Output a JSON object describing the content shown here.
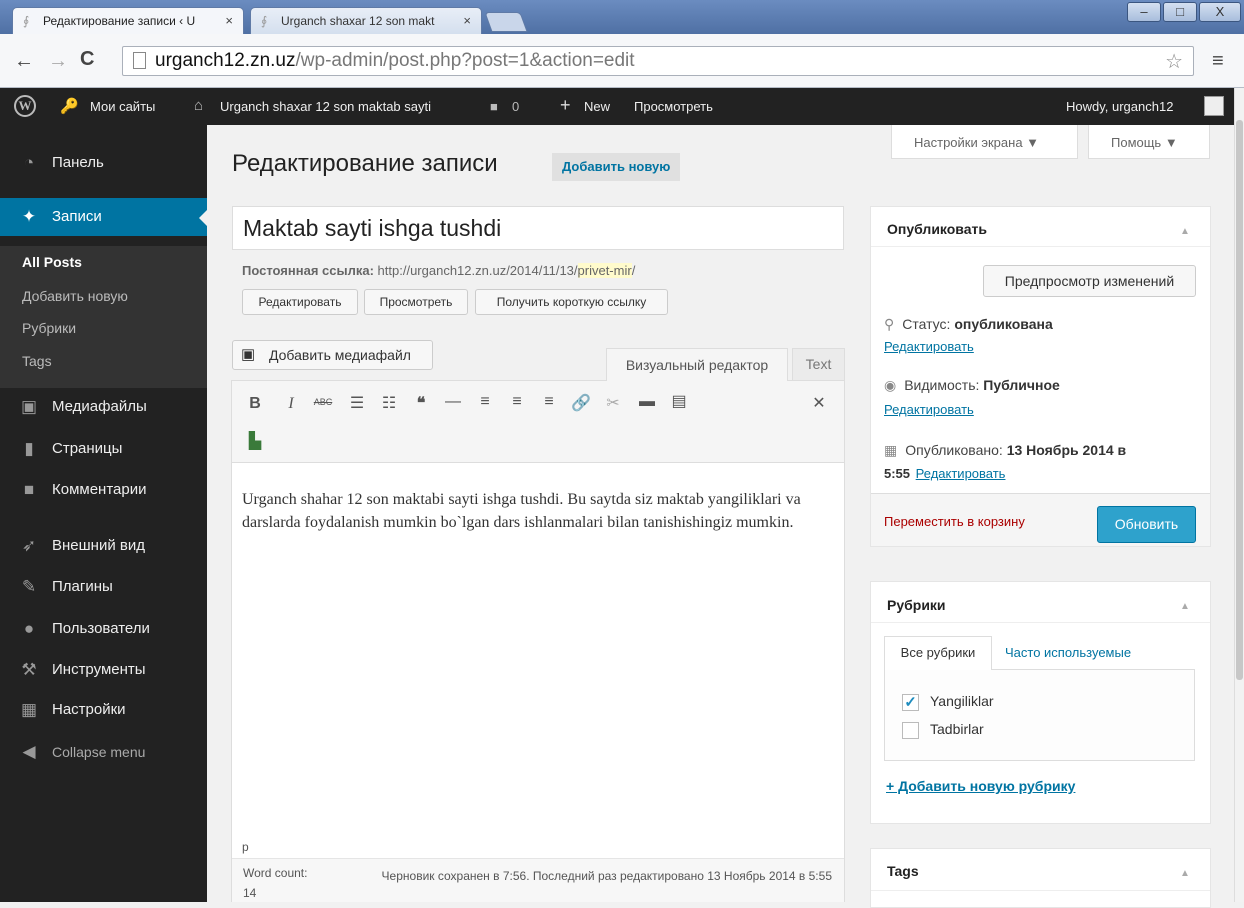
{
  "browser": {
    "tabs": [
      {
        "label": "Редактирование записи ‹ U"
      },
      {
        "label": "Urganch shaxar 12 son makt"
      }
    ],
    "tab_close": "×",
    "url_host": "urganch12.zn.uz",
    "url_path": "/wp-admin/post.php?post=1&action=edit",
    "window_min": "–",
    "window_max": "□",
    "window_close": "X"
  },
  "adminbar": {
    "my_sites": "Мои сайты",
    "site_name": "Urganch shaxar 12 son maktab sayti",
    "comments_count": "0",
    "new_label": "New",
    "view_label": "Просмотреть",
    "howdy": "Howdy, urganch12"
  },
  "sidebar": {
    "items": [
      {
        "label": "Панель",
        "icon": "dashboard-icon"
      },
      {
        "label": "Записи",
        "icon": "pin-icon"
      },
      {
        "label": "Медиафайлы",
        "icon": "media-icon"
      },
      {
        "label": "Страницы",
        "icon": "pages-icon"
      },
      {
        "label": "Комментарии",
        "icon": "comments-icon"
      },
      {
        "label": "Внешний вид",
        "icon": "appearance-icon"
      },
      {
        "label": "Плагины",
        "icon": "plugins-icon"
      },
      {
        "label": "Пользователи",
        "icon": "users-icon"
      },
      {
        "label": "Инструменты",
        "icon": "tools-icon"
      },
      {
        "label": "Настройки",
        "icon": "settings-icon"
      },
      {
        "label": "Collapse menu",
        "icon": "collapse-icon"
      }
    ],
    "submenu": [
      "All Posts",
      "Добавить новую",
      "Рубрики",
      "Tags"
    ]
  },
  "header": {
    "title": "Редактирование записи",
    "add_new": "Добавить новую",
    "screen_options": "Настройки экрана ▼",
    "help": "Помощь ▼"
  },
  "post": {
    "title": "Maktab sayti ishga tushdi",
    "permalink_label": "Постоянная ссылка:",
    "permalink_base": "http://urganch12.zn.uz/2014/11/13/",
    "permalink_slug": "privet-mir",
    "permalink_trail": "/",
    "btn_edit": "Редактировать",
    "btn_view": "Просмотреть",
    "btn_shortlink": "Получить короткую ссылку",
    "add_media": "Добавить медиафайл",
    "tab_visual": "Визуальный редактор",
    "tab_text": "Text",
    "content": "Urganch shahar 12 son maktabi sayti ishga tushdi. Bu saytda siz maktab yangiliklari va darslarda foydalanish mumkin bo`lgan dars ishlanmalari bilan tanishishingiz mumkin.",
    "path": "p",
    "word_count_label": "Word count:",
    "word_count": "14",
    "autosave": "Черновик сохранен в 7:56. Последний раз редактировано 13 Ноябрь 2014 в 5:55"
  },
  "publish": {
    "title": "Опубликовать",
    "preview": "Предпросмотр изменений",
    "status_label": "Статус:",
    "status_value": "опубликована",
    "visibility_label": "Видимость:",
    "visibility_value": "Публичное",
    "published_label": "Опубликовано:",
    "published_value": "13 Ноябрь 2014 в",
    "published_time": "5:55",
    "edit_link": "Редактировать",
    "trash": "Переместить в корзину",
    "update": "Обновить"
  },
  "categories": {
    "title": "Рубрики",
    "tab_all": "Все рубрики",
    "tab_popular": "Часто используемые",
    "items": [
      {
        "label": "Yangiliklar",
        "checked": true
      },
      {
        "label": "Tadbirlar",
        "checked": false
      }
    ],
    "add_new": "+ Добавить новую рубрику"
  },
  "tags": {
    "title": "Tags"
  },
  "colors": {
    "accent": "#0074a2",
    "update_button": "#2ea2cc",
    "sidebar_bg": "#222222"
  }
}
